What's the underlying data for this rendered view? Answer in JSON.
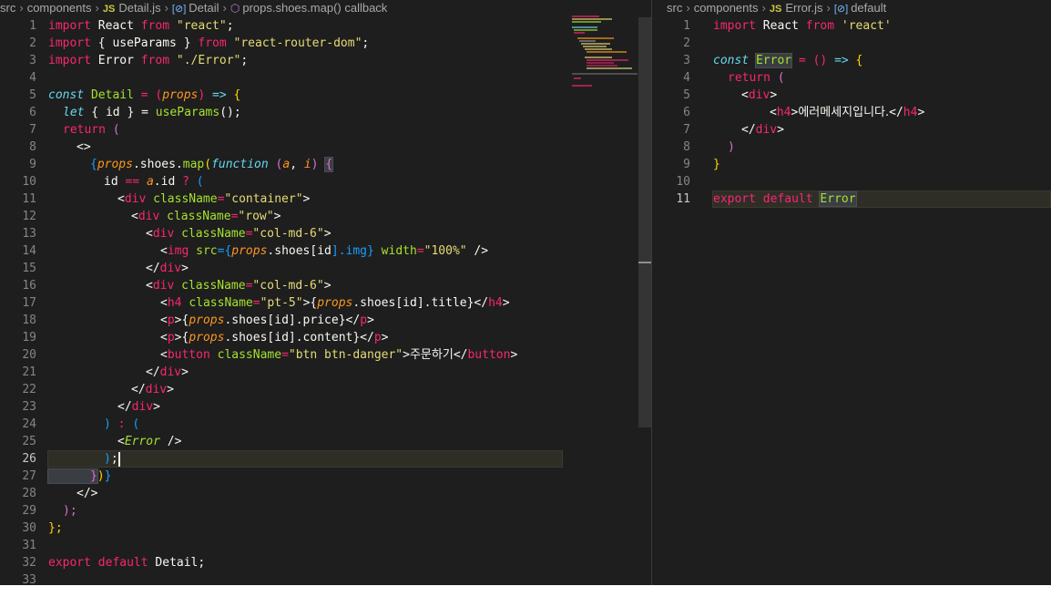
{
  "left_editor": {
    "breadcrumb": {
      "folder1": "src",
      "folder2": "components",
      "file_badge": "JS",
      "file": "Detail.js",
      "symbol1_badge": "[⊘]",
      "symbol1": "Detail",
      "symbol2": "props.shoes.map() callback"
    },
    "line_numbers": [
      "1",
      "2",
      "3",
      "4",
      "5",
      "6",
      "7",
      "8",
      "9",
      "10",
      "11",
      "12",
      "13",
      "14",
      "15",
      "16",
      "17",
      "18",
      "19",
      "20",
      "21",
      "22",
      "23",
      "24",
      "25",
      "26",
      "27",
      "28",
      "29",
      "30",
      "31",
      "32",
      "33"
    ],
    "active_line": "26",
    "code": {
      "l1": [
        "import",
        " React ",
        "from",
        " ",
        "\"react\"",
        ";"
      ],
      "l2": [
        "import",
        " { useParams } ",
        "from",
        " ",
        "\"react-router-dom\"",
        ";"
      ],
      "l3": [
        "import",
        " Error ",
        "from",
        " ",
        "\"./Error\"",
        ";"
      ],
      "l5": [
        "const",
        " ",
        "Detail",
        " = (",
        "props",
        ") ",
        "=>",
        " {"
      ],
      "l6": [
        "let",
        " { id } = ",
        "useParams",
        "();"
      ],
      "l7": [
        "return",
        " ("
      ],
      "l8": [
        "<>"
      ],
      "l9": [
        "{",
        "props",
        ".shoes.",
        "map",
        "(",
        "function",
        " (",
        "a",
        ", ",
        "i",
        ") ",
        "{"
      ],
      "l10": [
        "id",
        " == ",
        "a",
        ".id ",
        "?",
        " ("
      ],
      "l11": [
        "<",
        "div",
        " ",
        "className",
        "=",
        "\"container\"",
        ">"
      ],
      "l12": [
        "<",
        "div",
        " ",
        "className",
        "=",
        "\"row\"",
        ">"
      ],
      "l13": [
        "<",
        "div",
        " ",
        "className",
        "=",
        "\"col-md-6\"",
        ">"
      ],
      "l14": [
        "<",
        "img",
        " ",
        "src",
        "={",
        "props",
        ".shoes[",
        "id",
        "].img}",
        " ",
        "width",
        "=",
        "\"100%\"",
        " />"
      ],
      "l15": [
        "</",
        "div",
        ">"
      ],
      "l16": [
        "<",
        "div",
        " ",
        "className",
        "=",
        "\"col-md-6\"",
        ">"
      ],
      "l17": [
        "<",
        "h4",
        " ",
        "className",
        "=",
        "\"pt-5\"",
        ">{",
        "props",
        ".shoes[",
        "id",
        "].title}</",
        "h4",
        ">"
      ],
      "l18": [
        "<",
        "p",
        ">{",
        "props",
        ".shoes[",
        "id",
        "].price}</",
        "p",
        ">"
      ],
      "l19": [
        "<",
        "p",
        ">{",
        "props",
        ".shoes[",
        "id",
        "].content}</",
        "p",
        ">"
      ],
      "l20": [
        "<",
        "button",
        " ",
        "className",
        "=",
        "\"btn btn-danger\"",
        ">",
        "주문하기",
        "</",
        "button",
        ">"
      ],
      "l21": [
        "</",
        "div",
        ">"
      ],
      "l22": [
        "</",
        "div",
        ">"
      ],
      "l23": [
        "</",
        "div",
        ">"
      ],
      "l24": [
        ")",
        " : ",
        "("
      ],
      "l25": [
        "<",
        "Error",
        " />"
      ],
      "l26": [
        ")",
        ";"
      ],
      "l27": [
        "}",
        ")",
        "}"
      ],
      "l28": [
        "</>"
      ],
      "l29": [
        ");"
      ],
      "l30": [
        "};"
      ],
      "l32": [
        "export",
        " ",
        "default",
        " Detail;"
      ]
    }
  },
  "right_editor": {
    "breadcrumb": {
      "folder1": "src",
      "folder2": "components",
      "file_badge": "JS",
      "file": "Error.js",
      "symbol1_badge": "[⊘]",
      "symbol1": "default"
    },
    "line_numbers": [
      "1",
      "2",
      "3",
      "4",
      "5",
      "6",
      "7",
      "8",
      "9",
      "10",
      "11"
    ],
    "active_line": "11",
    "code": {
      "l1": [
        "import",
        " React ",
        "from",
        " ",
        "'react'"
      ],
      "l3": [
        "const",
        " ",
        "Error",
        " = () ",
        "=>",
        " {"
      ],
      "l4": [
        "return",
        " ("
      ],
      "l5": [
        "<",
        "div",
        ">"
      ],
      "l6": [
        "<",
        "h4",
        ">",
        "에러메세지입니다.",
        "</",
        "h4",
        ">"
      ],
      "l7": [
        "</",
        "div",
        ">"
      ],
      "l8": [
        ")"
      ],
      "l9": [
        "}"
      ],
      "l11": [
        "export",
        " ",
        "default",
        " ",
        "Error"
      ]
    }
  }
}
